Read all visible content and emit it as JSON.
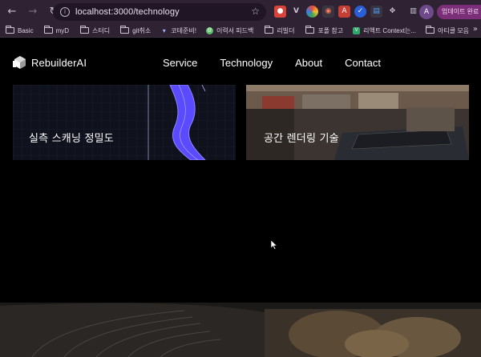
{
  "browser": {
    "url": "localhost:3000/technology",
    "update_label": "업데이트 완료",
    "profile_initial": "A",
    "bookmarks": [
      {
        "label": "Basic",
        "kind": "folder"
      },
      {
        "label": "myD",
        "kind": "folder"
      },
      {
        "label": "스터디",
        "kind": "folder"
      },
      {
        "label": "git취소",
        "kind": "folder"
      },
      {
        "label": "코테준비!",
        "kind": "link",
        "color": "#9fb6ff"
      },
      {
        "label": "이력서 피드백",
        "kind": "link",
        "color": "#5cc16a"
      },
      {
        "label": "리빌더",
        "kind": "folder"
      },
      {
        "label": "포폴 참고",
        "kind": "folder"
      },
      {
        "label": "리액트 Context는...",
        "kind": "link",
        "color": "#2fa86b"
      },
      {
        "label": "아티클 모음",
        "kind": "folder"
      }
    ]
  },
  "site": {
    "logo_text": "RebuilderAI",
    "nav": [
      "Service",
      "Technology",
      "About",
      "Contact"
    ]
  },
  "cards": [
    {
      "caption": "실측 스캐닝 정밀도"
    },
    {
      "caption": "공간 렌더링 기술"
    }
  ],
  "colors": {
    "chrome": "#2e2233",
    "omnibox": "#1f1524",
    "page_bg": "#000000",
    "scan_stroke": "#5b4bff",
    "update_btn": "#7a2f78"
  }
}
